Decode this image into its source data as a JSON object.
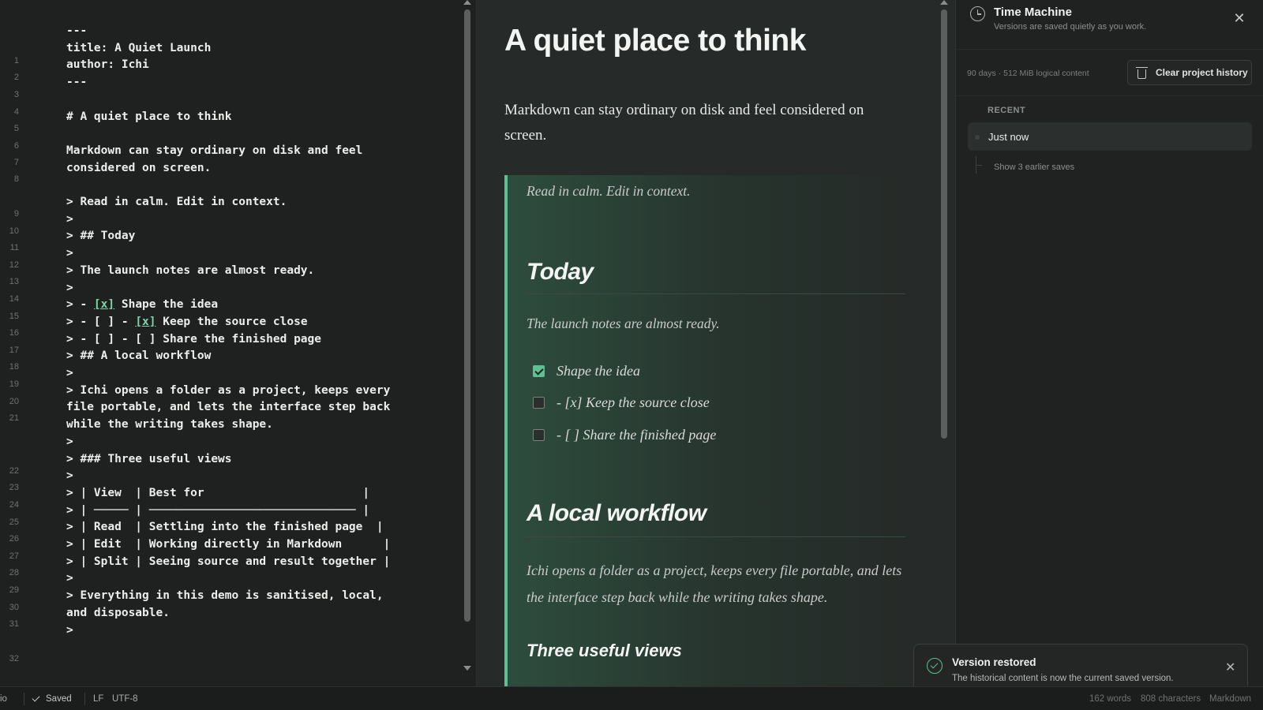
{
  "editor": {
    "line_numbers": [
      "1",
      "2",
      "3",
      "4",
      "5",
      "6",
      "7",
      "8",
      "9",
      "10",
      "11",
      "12",
      "13",
      "14",
      "15",
      "16",
      "17",
      "18",
      "19",
      "20",
      "21",
      "22",
      "23",
      "24",
      "25",
      "26",
      "27",
      "28",
      "29",
      "30",
      "31",
      "32"
    ],
    "lines": [
      "---",
      "title: A Quiet Launch",
      "author: Ichi",
      "---",
      "",
      "# A quiet place to think",
      "",
      "Markdown can stay ordinary on disk and feel",
      "considered on screen.",
      "",
      "> Read in calm. Edit in context.",
      ">",
      "> ## Today",
      ">",
      "> The launch notes are almost ready.",
      ">",
      "> - [x] Shape the idea",
      "> - [ ] - [x] Keep the source close",
      "> - [ ] - [ ] Share the finished page",
      "> ## A local workflow",
      ">",
      "> Ichi opens a folder as a project, keeps every",
      "file portable, and lets the interface step back",
      "while the writing takes shape.",
      ">",
      "> ### Three useful views",
      ">",
      "> | View  | Best for                       |",
      "> | ───── | ────────────────────────────── |",
      "> | Read  | Settling into the finished page  |",
      "> | Edit  | Working directly in Markdown      |",
      "> | Split | Seeing source and result together |",
      ">",
      "> Everything in this demo is sanitised, local,",
      "and disposable.",
      ">"
    ]
  },
  "preview": {
    "title": "A quiet place to think",
    "lead": "Markdown can stay ordinary on disk and feel considered on screen.",
    "quote_intro": "Read in calm. Edit in context.",
    "h2_today": "Today",
    "today_text": "The launch notes are almost ready.",
    "tasks": [
      {
        "label": "Shape the idea",
        "checked": true
      },
      {
        "label": "- [x] Keep the source close",
        "checked": false
      },
      {
        "label": "- [ ] Share the finished page",
        "checked": false
      }
    ],
    "h2_workflow": "A local workflow",
    "workflow_text": "Ichi opens a folder as a project, keeps every file portable, and lets the interface step back while the writing takes shape.",
    "h3_views": "Three useful views"
  },
  "time_machine": {
    "title": "Time Machine",
    "subtitle": "Versions are saved quietly as you work.",
    "close_glyph": "✕",
    "meta": "90 days · 512 MiB logical content",
    "clear_label": "Clear project history",
    "recent_label": "RECENT",
    "item_label": "Just now",
    "earlier_label": "Show 3 earlier saves"
  },
  "toast": {
    "title": "Version restored",
    "message": "The historical content is now the current saved version.",
    "close_glyph": "✕"
  },
  "status": {
    "mode": "io",
    "saved": "Saved",
    "line_ending": "LF",
    "encoding": "UTF-8",
    "words": "162 words",
    "characters": "808 characters",
    "language": "Markdown"
  },
  "colors": {
    "accent": "#5fc092",
    "background": "#1e2120",
    "preview_background": "#262a28"
  }
}
